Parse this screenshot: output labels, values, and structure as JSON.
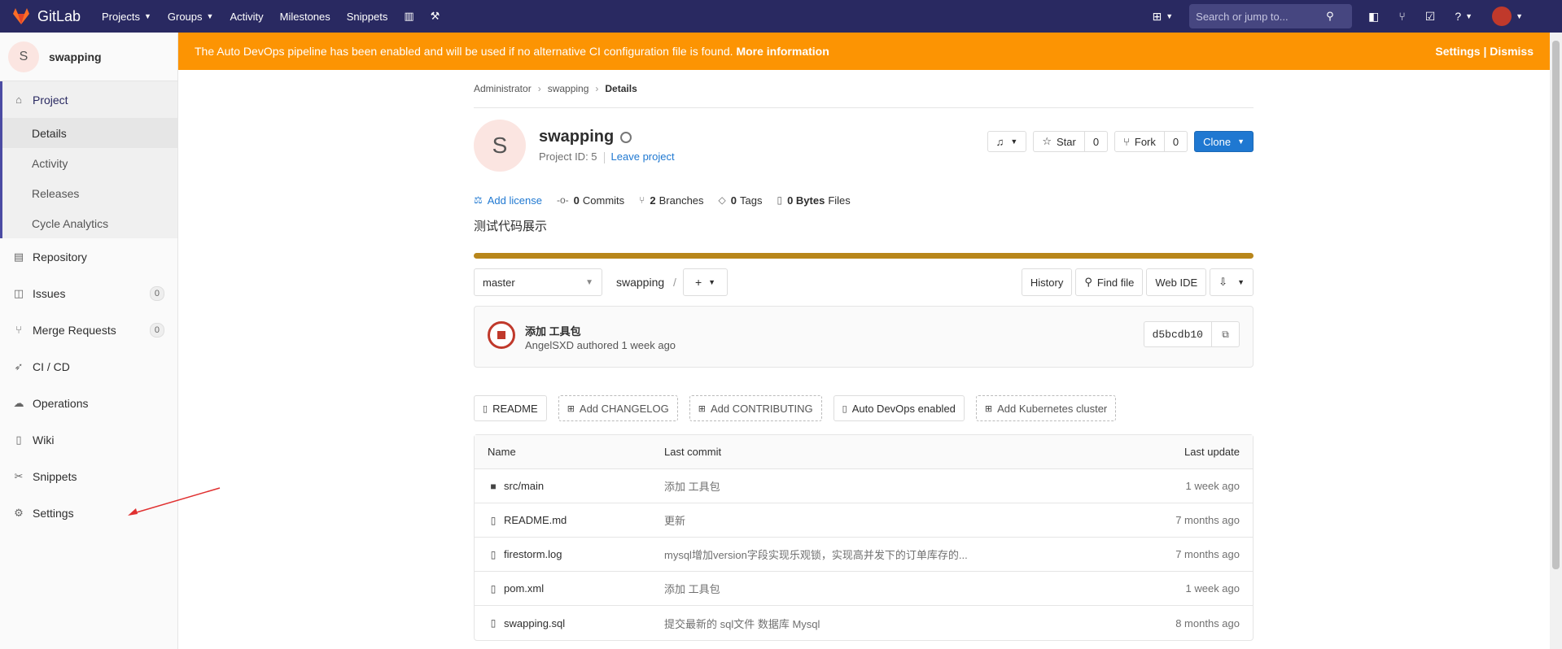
{
  "navbar": {
    "brand": "GitLab",
    "links": [
      {
        "label": "Projects",
        "dropdown": true
      },
      {
        "label": "Groups",
        "dropdown": true
      },
      {
        "label": "Activity",
        "dropdown": false
      },
      {
        "label": "Milestones",
        "dropdown": false
      },
      {
        "label": "Snippets",
        "dropdown": false
      }
    ],
    "search_placeholder": "Search or jump to..."
  },
  "sidebar": {
    "project_initial": "S",
    "project_name": "swapping",
    "project_label": "Project",
    "sub_items": [
      "Details",
      "Activity",
      "Releases",
      "Cycle Analytics"
    ],
    "items": [
      {
        "label": "Repository"
      },
      {
        "label": "Issues",
        "count": "0"
      },
      {
        "label": "Merge Requests",
        "count": "0"
      },
      {
        "label": "CI / CD"
      },
      {
        "label": "Operations"
      },
      {
        "label": "Wiki"
      },
      {
        "label": "Snippets"
      },
      {
        "label": "Settings"
      }
    ]
  },
  "banner": {
    "text": "The Auto DevOps pipeline has been enabled and will be used if no alternative CI configuration file is found.",
    "link": "More information",
    "settings": "Settings",
    "sep": "|",
    "dismiss": "Dismiss"
  },
  "breadcrumb": [
    "Administrator",
    "swapping",
    "Details"
  ],
  "project": {
    "initial": "S",
    "name": "swapping",
    "id_text": "Project ID: 5",
    "leave": "Leave project",
    "star_label": "Star",
    "star_count": "0",
    "fork_label": "Fork",
    "fork_count": "0",
    "clone_label": "Clone",
    "description": "测试代码展示"
  },
  "stats": {
    "add_license": "Add license",
    "commits_num": "0",
    "commits_label": "Commits",
    "branches_num": "2",
    "branches_label": "Branches",
    "tags_num": "0",
    "tags_label": "Tags",
    "size_num": "0 Bytes",
    "size_label": "Files"
  },
  "tree": {
    "branch": "master",
    "path": "swapping",
    "path_sep": "/",
    "history": "History",
    "find_file": "Find file",
    "web_ide": "Web IDE"
  },
  "commit": {
    "title": "添加 工具包",
    "author": "AngelSXD",
    "meta_rest": "authored 1 week ago",
    "sha": "d5bcdb10"
  },
  "quick_links": [
    {
      "label": "README",
      "dashed": false,
      "icon": "file-icon"
    },
    {
      "label": "Add CHANGELOG",
      "dashed": true,
      "icon": "plus-square-icon"
    },
    {
      "label": "Add CONTRIBUTING",
      "dashed": true,
      "icon": "plus-square-icon"
    },
    {
      "label": "Auto DevOps enabled",
      "dashed": false,
      "icon": "file-icon"
    },
    {
      "label": "Add Kubernetes cluster",
      "dashed": true,
      "icon": "plus-square-icon"
    }
  ],
  "files": {
    "headers": {
      "name": "Name",
      "commit": "Last commit",
      "date": "Last update"
    },
    "rows": [
      {
        "name": "src/main",
        "type": "folder",
        "commit": "添加 工具包",
        "date": "1 week ago"
      },
      {
        "name": "README.md",
        "type": "file",
        "commit": "更新",
        "date": "7 months ago"
      },
      {
        "name": "firestorm.log",
        "type": "file",
        "commit": "mysql增加version字段实现乐观锁，实现高并发下的订单库存的...",
        "date": "7 months ago"
      },
      {
        "name": "pom.xml",
        "type": "file",
        "commit": "添加 工具包",
        "date": "1 week ago"
      },
      {
        "name": "swapping.sql",
        "type": "file",
        "commit": "提交最新的 sql文件 数据库 Mysql",
        "date": "8 months ago"
      }
    ]
  },
  "colors": {
    "navbar": "#292961",
    "banner": "#fc9403",
    "primary": "#1f78d1",
    "progress": "#b8861b"
  }
}
